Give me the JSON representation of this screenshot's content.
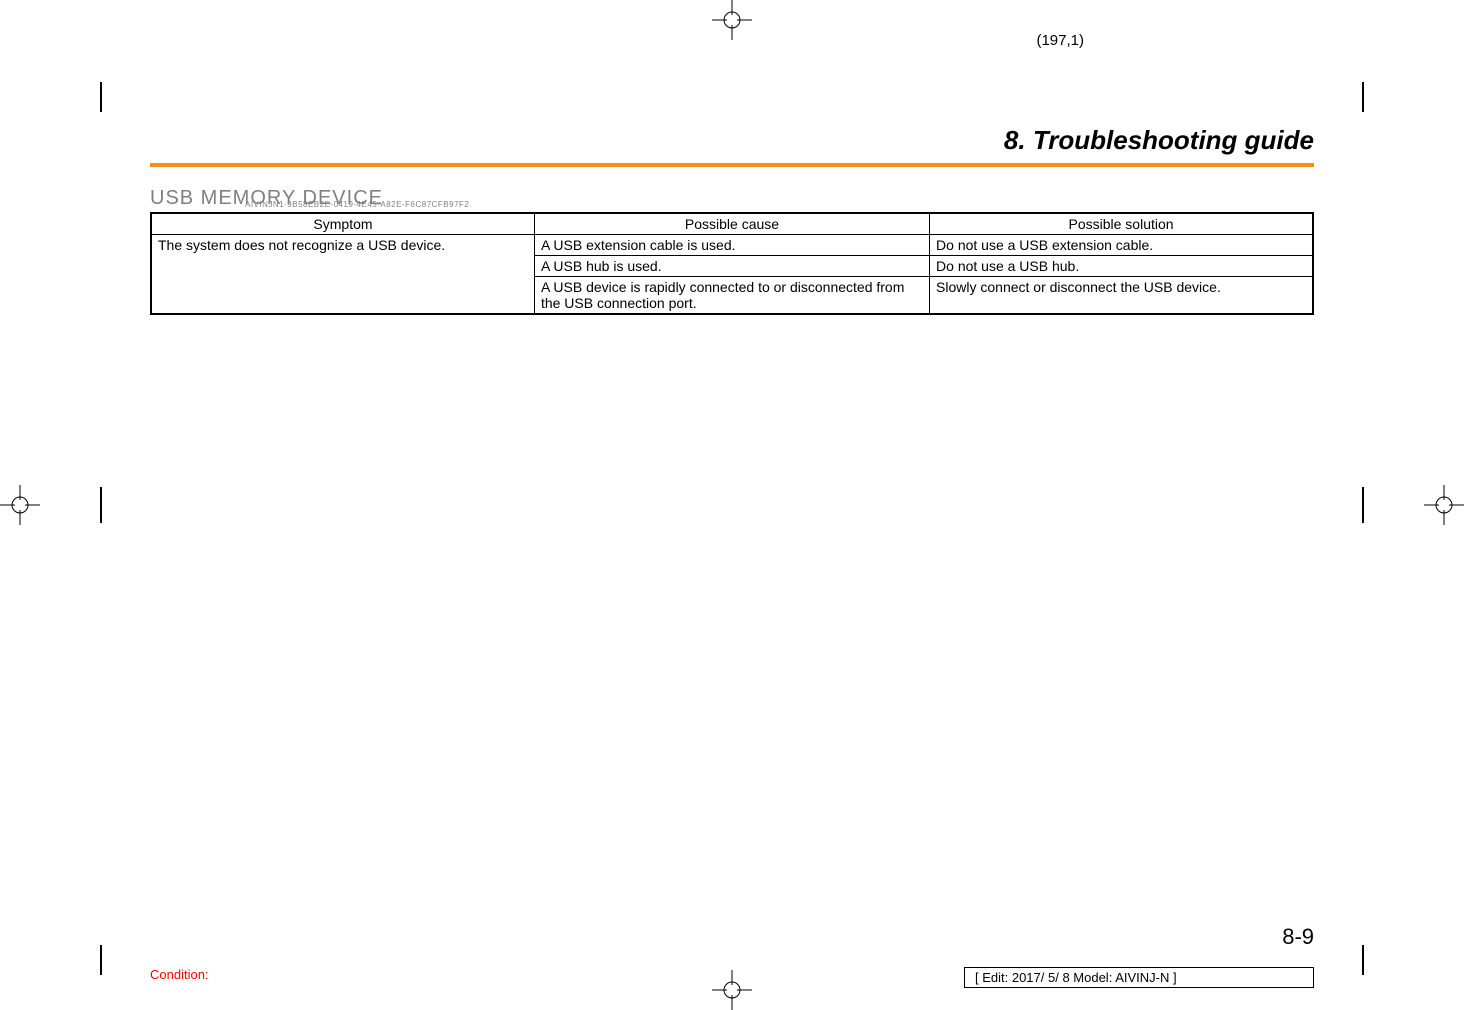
{
  "page_coord": "(197,1)",
  "chapter_title": "8. Troubleshooting guide",
  "section_heading": "USB MEMORY DEVICE",
  "heading_sub": "AIVINJN1-9B58EB2E-0419-4E45-A82E-F6C87CFB97F2",
  "table": {
    "headers": {
      "c1": "Symptom",
      "c2": "Possible cause",
      "c3": "Possible solution"
    },
    "symptom": "The system does not recognize a USB device.",
    "rows": [
      {
        "cause": "A USB extension cable is used.",
        "solution": "Do not use a USB extension cable."
      },
      {
        "cause": "A USB hub is used.",
        "solution": "Do not use a USB hub."
      },
      {
        "cause": "A USB device is rapidly connected to or disconnected from the USB connection port.",
        "solution": "Slowly connect or disconnect the USB device."
      }
    ]
  },
  "page_num": "8-9",
  "condition": "Condition:",
  "edit_box": "[ Edit: 2017/ 5/ 8   Model: AIVINJ-N ]"
}
